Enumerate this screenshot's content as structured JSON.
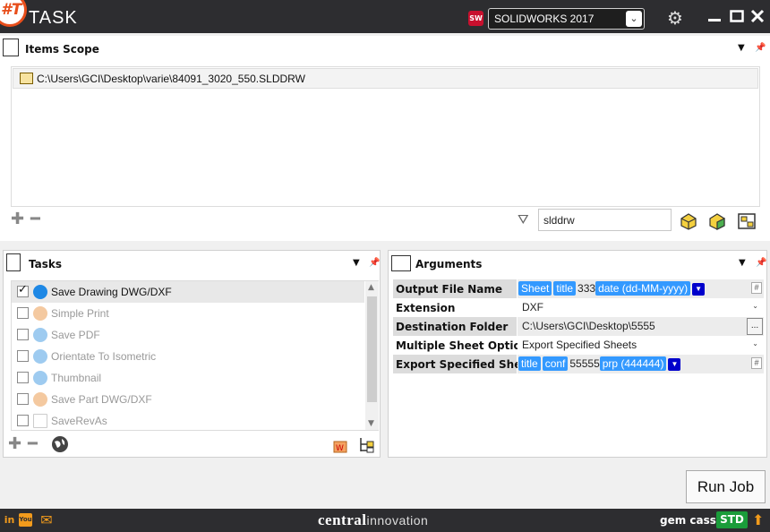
{
  "app": {
    "title": "TASK",
    "logo_text": "#T",
    "cad_badge": "SW",
    "version": "SOLIDWORKS 2017"
  },
  "icons": {
    "settings": "gear-icon",
    "minimize": "minimize-icon",
    "maximize": "maximize-icon",
    "close": "close-icon"
  },
  "items_scope": {
    "title": "Items Scope",
    "items": [
      "C:\\Users\\GCI\\Desktop\\varie\\84091_3020_550.SLDDRW"
    ],
    "filter_value": "slddrw"
  },
  "tasks": {
    "title": "Tasks",
    "items": [
      {
        "label": "Save Drawing DWG/DXF",
        "checked": true,
        "enabled": true,
        "color": "#1e88e5"
      },
      {
        "label": "Simple Print",
        "checked": false,
        "enabled": false,
        "color": "#f4c9a0"
      },
      {
        "label": "Save PDF",
        "checked": false,
        "enabled": false,
        "color": "#9ecbf0"
      },
      {
        "label": "Orientate To Isometric",
        "checked": false,
        "enabled": false,
        "color": "#9ecbf0"
      },
      {
        "label": "Thumbnail",
        "checked": false,
        "enabled": false,
        "color": "#9ecbf0"
      },
      {
        "label": "Save Part DWG/DXF",
        "checked": false,
        "enabled": false,
        "color": "#f4c9a0"
      },
      {
        "label": "SaveRevAs",
        "checked": false,
        "enabled": false,
        "color": "#ffffff"
      }
    ]
  },
  "arguments": {
    "title": "Arguments",
    "rows": {
      "output_file_name": {
        "label": "Output File Name",
        "chips": [
          "Sheet",
          "title"
        ],
        "text": "333",
        "chip2": "date (dd-MM-yyyy)"
      },
      "extension": {
        "label": "Extension",
        "value": "DXF"
      },
      "destination": {
        "label": "Destination Folder",
        "value": "C:\\Users\\GCI\\Desktop\\5555",
        "browse": "..."
      },
      "multi_sheet": {
        "label": "Multiple Sheet Options",
        "value": "Export Specified Sheets"
      },
      "export_sheets": {
        "label": "Export Specified Sheets",
        "chips": [
          "title",
          "conf"
        ],
        "text": "55555",
        "chip2": "prp (444444)"
      }
    },
    "hash": "#"
  },
  "run_button": "Run Job",
  "footer": {
    "social": [
      "in",
      "You",
      "✉"
    ],
    "brand_bold": "central",
    "brand_light": "innovation",
    "user": "gem cassa",
    "license": "STD"
  },
  "colors": {
    "titlebar": "#2d2d30",
    "accent": "#3399ff",
    "license": "#1a9c3a",
    "orange": "#f29b1c"
  }
}
